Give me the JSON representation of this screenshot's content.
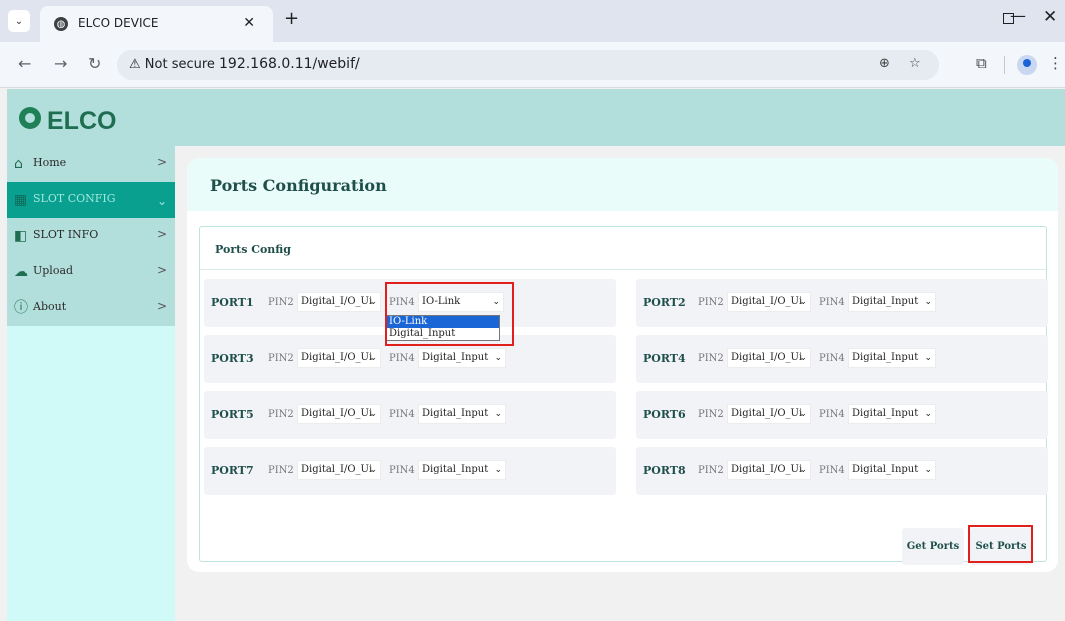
{
  "browser": {
    "tab_title": "ELCO DEVICE",
    "not_secure": "Not secure",
    "url": "192.168.0.11/webif/"
  },
  "brand": {
    "name": "ELCO"
  },
  "sidebar": {
    "items": [
      {
        "label": "Home",
        "icon": "home-icon"
      },
      {
        "label": "SLOT CONFIG",
        "icon": "slot-config-icon",
        "active": true
      },
      {
        "label": "SLOT INFO",
        "icon": "slot-info-icon"
      },
      {
        "label": "Upload",
        "icon": "upload-icon"
      },
      {
        "label": "About",
        "icon": "info-icon"
      }
    ]
  },
  "main": {
    "title": "Ports Configuration",
    "section_title": "Ports Config",
    "pin2_label": "PIN2",
    "pin4_label": "PIN4",
    "ports": [
      {
        "name": "PORT1",
        "pin2": "Digital_I/O_Ui",
        "pin4": "IO-Link"
      },
      {
        "name": "PORT2",
        "pin2": "Digital_I/O_Ui",
        "pin4": "Digital_Input"
      },
      {
        "name": "PORT3",
        "pin2": "Digital_I/O_Ui",
        "pin4": "Digital_Input"
      },
      {
        "name": "PORT4",
        "pin2": "Digital_I/O_Ui",
        "pin4": "Digital_Input"
      },
      {
        "name": "PORT5",
        "pin2": "Digital_I/O_Ui",
        "pin4": "Digital_Input"
      },
      {
        "name": "PORT6",
        "pin2": "Digital_I/O_Ui",
        "pin4": "Digital_Input"
      },
      {
        "name": "PORT7",
        "pin2": "Digital_I/O_Ui",
        "pin4": "Digital_Input"
      },
      {
        "name": "PORT8",
        "pin2": "Digital_I/O_Ui",
        "pin4": "Digital_Input"
      }
    ],
    "dropdown_options": [
      "IO-Link",
      "Digital_Input"
    ],
    "get_ports_label": "Get Ports",
    "set_ports_label": "Set Ports"
  },
  "colors": {
    "brand_bar": "#b2dedb",
    "sidebar_active": "#0aa08f",
    "highlight": "#e0201c",
    "dropdown_selected": "#1a66d6"
  }
}
